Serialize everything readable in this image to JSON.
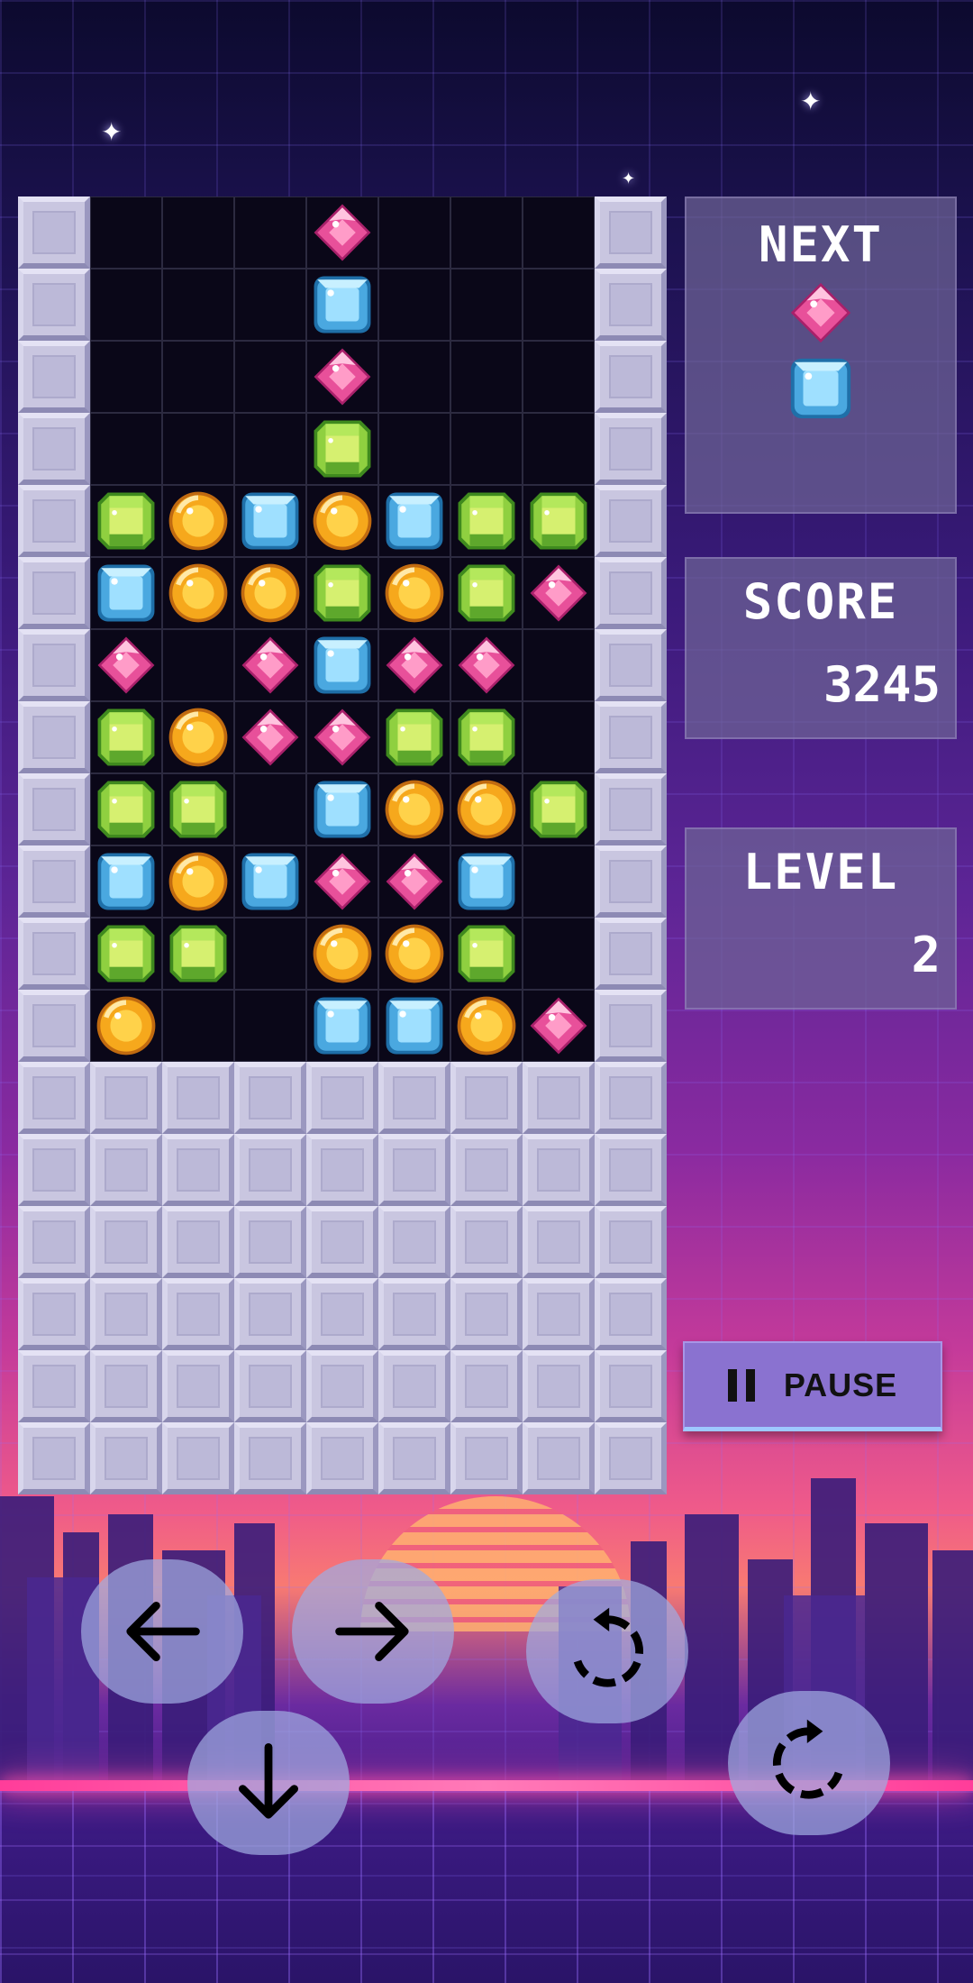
{
  "next_panel": {
    "title": "NEXT",
    "pieces": [
      "pink",
      "blue"
    ]
  },
  "score_panel": {
    "title": "SCORE",
    "value": "3245"
  },
  "level_panel": {
    "title": "LEVEL",
    "value": "2"
  },
  "pause": {
    "label": "PAUSE",
    "icon": "pause-icon"
  },
  "controls": [
    {
      "name": "move-left-button",
      "icon": "arrow-left-icon"
    },
    {
      "name": "move-right-button",
      "icon": "arrow-right-icon"
    },
    {
      "name": "rotate-left-button",
      "icon": "rotate-ccw-icon"
    },
    {
      "name": "drop-down-button",
      "icon": "arrow-down-icon"
    },
    {
      "name": "rotate-right-button",
      "icon": "rotate-cw-icon"
    }
  ],
  "gem_colors": {
    "pink": "#e8509a",
    "blue": "#4aa8e0",
    "green": "#8fd040",
    "orange": "#f6a81c"
  },
  "board": {
    "legend": "W=wall, .=empty, P=pink, B=blue, G=green, O=orange",
    "rows": [
      "W...P...W",
      "W...B...W",
      "W...P...W",
      "W...G...W",
      "WGOBOBGGW",
      "WBOOGOGPW",
      "WP.PBPP.W",
      "WGOPPGG.W",
      "WGG.BOOGW",
      "WBOBPPB.W",
      "WGG.OOG.W",
      "WO..BBOPW",
      "WWWWWWWWW",
      "WWWWWWWWW",
      "WWWWWWWWW",
      "WWWWWWWWW",
      "WWWWWWWWW",
      "WWWWWWWWW"
    ]
  }
}
